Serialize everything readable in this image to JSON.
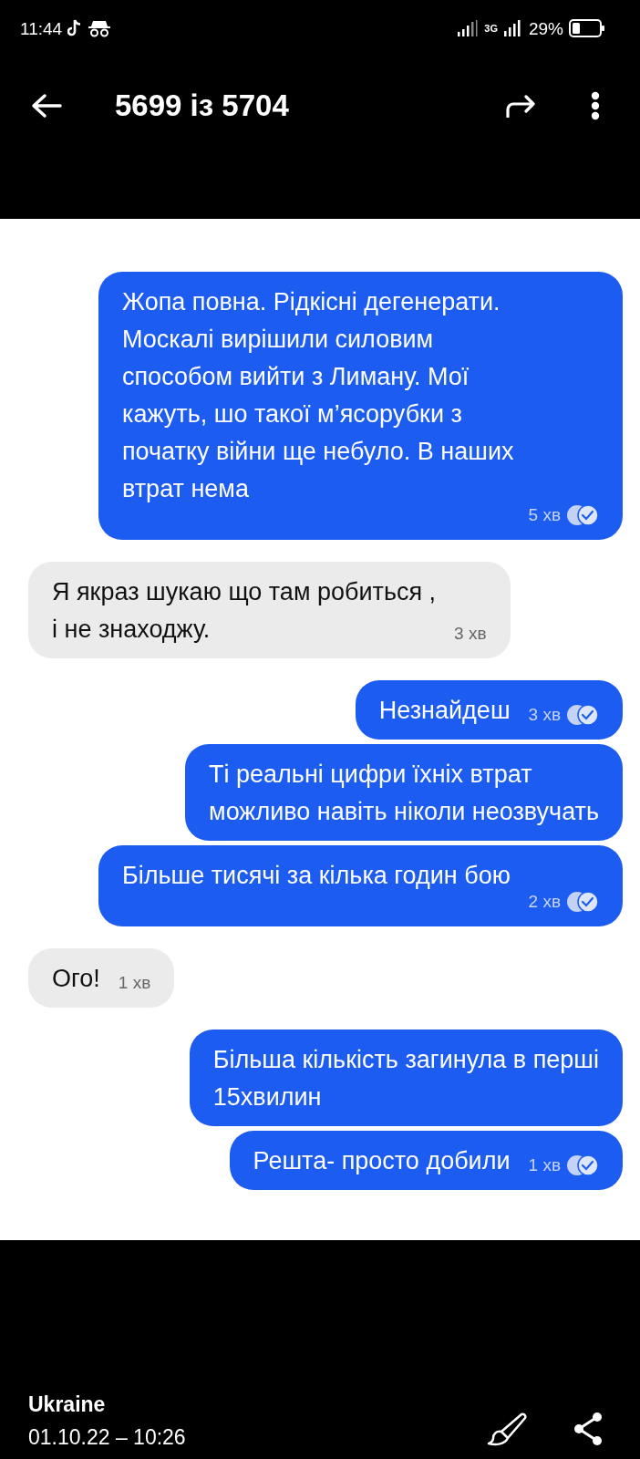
{
  "status_bar": {
    "time": "11:44",
    "network": "3G",
    "battery": "29%"
  },
  "header": {
    "title": "5699 із 5704"
  },
  "messages": [
    {
      "kind": "out",
      "lines": [
        "Жопа повна. Рідкісні дегенерати.",
        "Москалі вирішили силовим",
        "способом вийти з Лиману. Мої",
        "кажуть, шо такої м’ясорубки з",
        "початку війни ще небуло. В наших",
        "втрат нема"
      ],
      "time": "5 хв",
      "read": true
    },
    {
      "kind": "in",
      "lines": [
        "Я якраз шукаю що там робиться ,",
        "і не знаходжу."
      ],
      "time": "3 хв"
    },
    {
      "kind": "out",
      "lines": [
        "Незнайдеш"
      ],
      "time": "3 хв",
      "read": true
    },
    {
      "kind": "out",
      "lines": [
        "Ті реальні цифри їхніх втрат",
        "можливо навіть ніколи неозвучать"
      ]
    },
    {
      "kind": "out",
      "lines": [
        "Більше тисячі за кілька годин бою"
      ],
      "time": "2 хв",
      "read": true
    },
    {
      "kind": "in",
      "lines": [
        "Ого!"
      ],
      "time": "1 хв"
    },
    {
      "kind": "out",
      "lines": [
        "Більша кількість загинула в перші",
        "15хвилин"
      ]
    },
    {
      "kind": "out",
      "lines": [
        "Решта- просто добили"
      ],
      "time": "1 хв",
      "read": true
    }
  ],
  "footer": {
    "location": "Ukraine",
    "datetime": "01.10.22 – 10:26"
  }
}
